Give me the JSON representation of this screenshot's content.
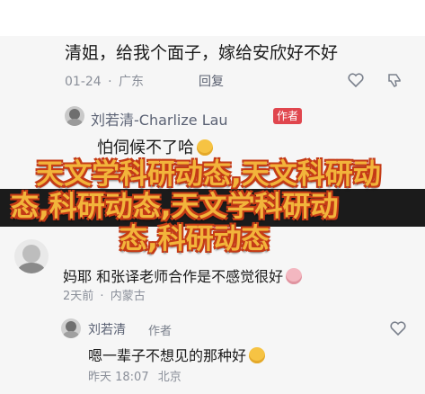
{
  "comments": [
    {
      "text": "清姐，给我个面子，嫁给安欣好不好",
      "date": "01-24",
      "location": "广东",
      "reply_label": "回复",
      "reply": {
        "author": "刘若清-Charlize Lau",
        "author_badge": "作者",
        "text": "怕伺候不了哈"
      }
    },
    {
      "text": "妈耶 和张译老师合作是不感觉很好",
      "date": "2天前",
      "location": "内蒙古",
      "reply": {
        "author": "刘若清",
        "author_tag": "作者",
        "text": "嗯一辈子不想见的那种好",
        "date": "昨天 18:07",
        "location": "北京"
      }
    }
  ],
  "overlay": {
    "lines": [
      "天文学科研动态,天文科研动",
      "态,科研动态,天文学科研动",
      "态,科研动态"
    ]
  },
  "icons": {
    "like": "heart-icon",
    "dislike": "thumbs-down-icon",
    "emoji_grin": "grinning-sweat-emoji",
    "emoji_pig": "pig-face-emoji"
  },
  "colors": {
    "overlay_fill": "#f2b43b",
    "overlay_stroke": "#c43a16",
    "author_badge": "#e0464e"
  }
}
